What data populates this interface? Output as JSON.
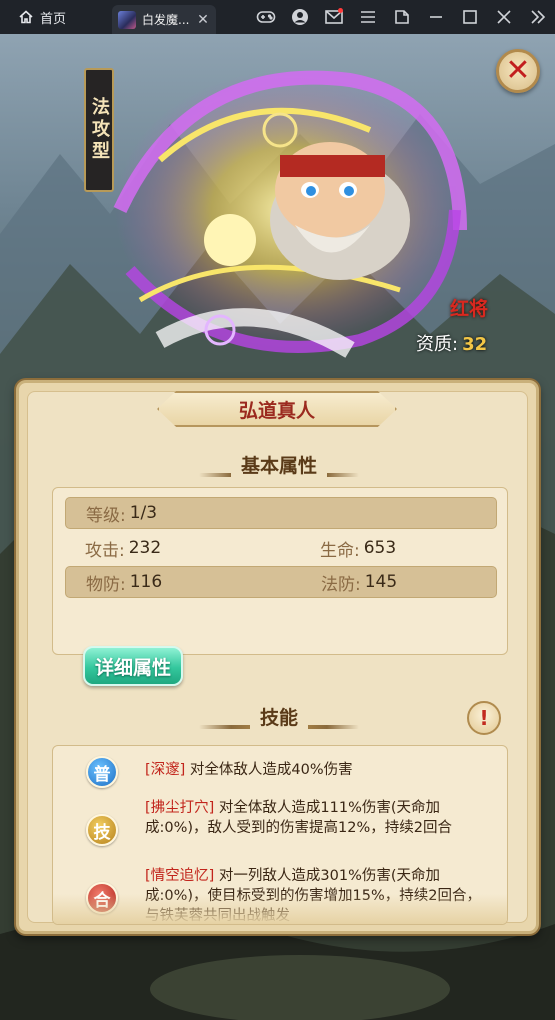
{
  "titlebar": {
    "home_label": "首页",
    "game_tab_label": "白发魔...",
    "tab_close": "✕"
  },
  "hero": {
    "type_label": "法攻型",
    "rarity": "红将",
    "aptitude_label": "资质:",
    "aptitude_value": "32",
    "name": "弘道真人"
  },
  "panel": {
    "close_symbol": "✕",
    "basic_title": "基本属性",
    "skills_title": "技能",
    "detail_button": "详细属性",
    "warn_symbol": "!"
  },
  "stats": {
    "level_label": "等级:",
    "level_value": "1/3",
    "attack_label": "攻击:",
    "attack_value": "232",
    "hp_label": "生命:",
    "hp_value": "653",
    "pdef_label": "物防:",
    "pdef_value": "116",
    "mdef_label": "法防:",
    "mdef_value": "145"
  },
  "skills": [
    {
      "badge": "普",
      "color": "blue",
      "name": "[深邃]",
      "text": " 对全体敌人造成40%伤害"
    },
    {
      "badge": "技",
      "color": "gold",
      "name": "[拂尘打穴]",
      "text": " 对全体敌人造成111%伤害(天命加成:0%)，敌人受到的伤害提高12%，持续2回合"
    },
    {
      "badge": "合",
      "color": "red",
      "name": "[情空追忆]",
      "text": " 对一列敌人造成301%伤害(天命加成:0%)，使目标受到的伤害增加15%，持续2回合，与铁芙蓉共同出战触发"
    }
  ],
  "colors": {
    "name_red": "#9b2a1f",
    "skill_name_red": "#c2251c",
    "aptitude_gold": "#f3c646",
    "button_green": "#34c79d"
  }
}
